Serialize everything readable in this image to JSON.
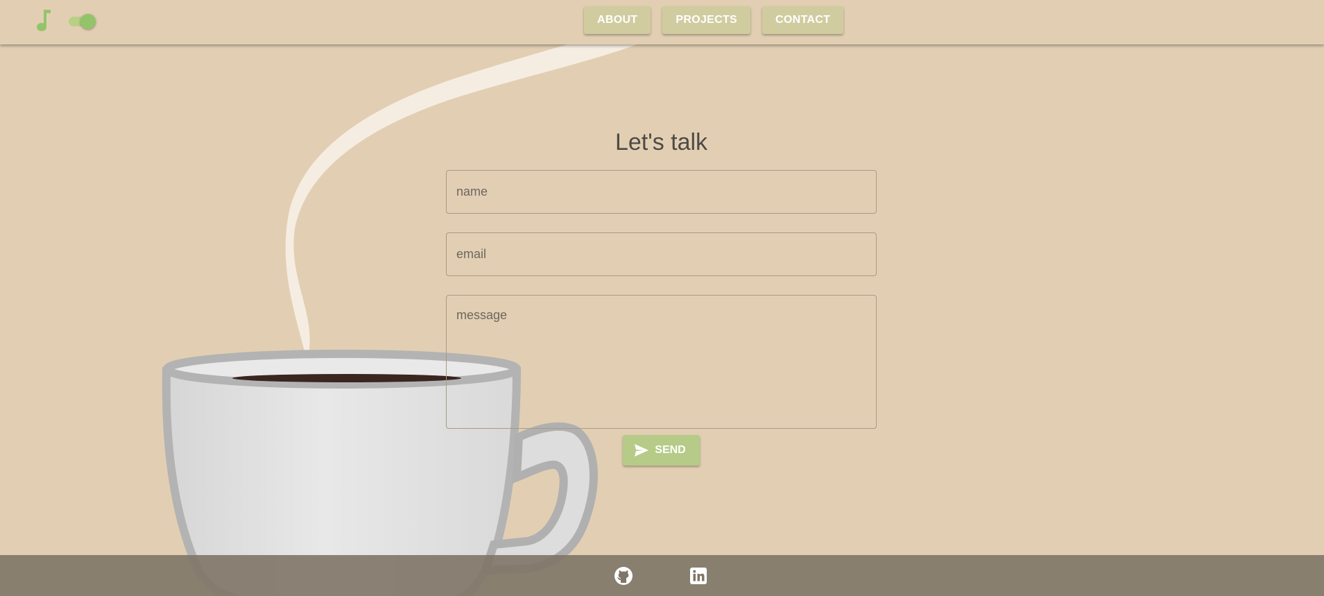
{
  "header": {
    "nav": [
      {
        "label": "ABOUT"
      },
      {
        "label": "PROJECTS"
      },
      {
        "label": "CONTACT"
      }
    ],
    "music_icon": "music-note-icon",
    "music_toggle": {
      "state": "on"
    }
  },
  "contact": {
    "title": "Let's talk",
    "name_placeholder": "name",
    "email_placeholder": "email",
    "message_placeholder": "message",
    "send_label": "SEND",
    "send_icon": "send-icon"
  },
  "footer": {
    "links": [
      {
        "icon": "github-icon"
      },
      {
        "icon": "linkedin-icon"
      }
    ]
  },
  "colors": {
    "background": "#e2cfb3",
    "nav_button": "#d0cc9f",
    "accent_green": "#93c46a",
    "send_button": "#b6cb87",
    "footer": "#807567",
    "title_text": "#4e4a45"
  }
}
